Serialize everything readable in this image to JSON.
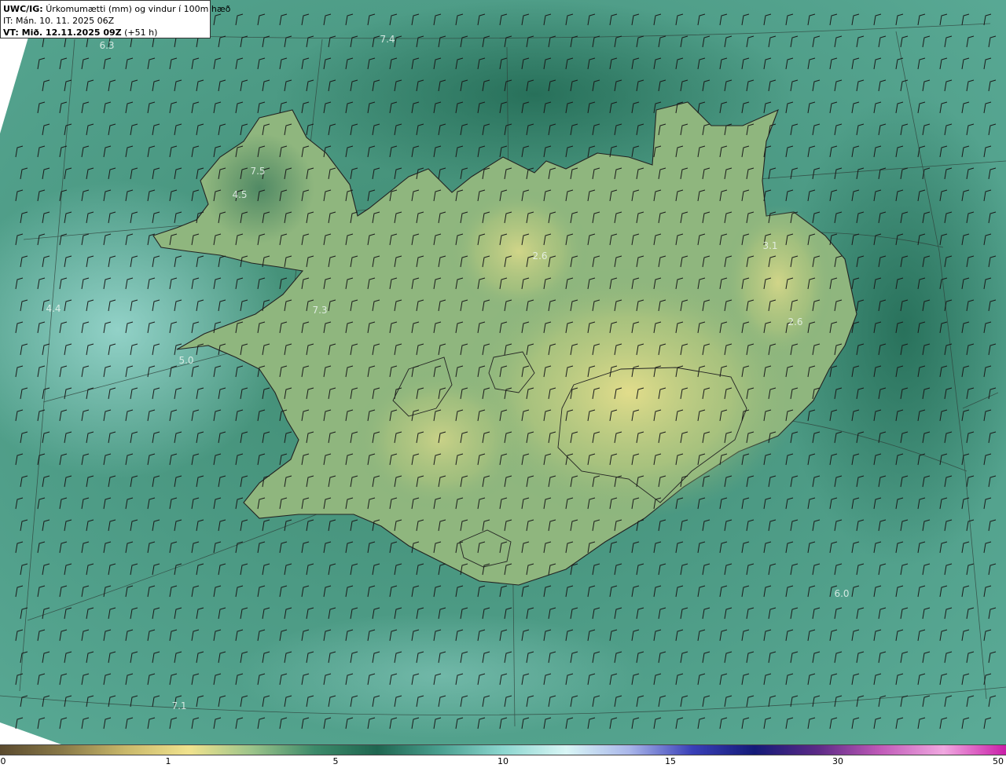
{
  "header": {
    "model": "UWC/IG:",
    "title": "Úrkomumætti (mm) og vindur í 100m hæð",
    "it_line": "IT: Mán. 10. 11. 2025 06Z",
    "vt_label": "VT: Mið. 12.11.2025 09Z",
    "vt_offset": "(+51 h)"
  },
  "map_labels": [
    {
      "text": "6.3",
      "id": "label-6-3"
    },
    {
      "text": "7.4",
      "id": "label-7-4"
    },
    {
      "text": "7.5",
      "id": "label-7-5"
    },
    {
      "text": "4.5",
      "id": "label-4-5"
    },
    {
      "text": "2.6",
      "id": "label-2-6"
    },
    {
      "text": "4.4",
      "id": "label-4-4"
    },
    {
      "text": "7.3",
      "id": "label-7-3"
    },
    {
      "text": "5.0",
      "id": "label-5-0"
    },
    {
      "text": "3.1",
      "id": "label-3-1"
    },
    {
      "text": "2.6",
      "id": "label-2-6b"
    },
    {
      "text": "6.0",
      "id": "label-6-0"
    },
    {
      "text": "7.1",
      "id": "label-7-1"
    }
  ],
  "colorbar": {
    "ticks": [
      "0",
      "1",
      "5",
      "10",
      "15",
      "30",
      "50"
    ],
    "colors": [
      "#5a4a2e",
      "#8a7a48",
      "#c9b86a",
      "#f1e38e",
      "#9cc48a",
      "#3c8a6a",
      "#1f6650",
      "#4aa090",
      "#8cd6cf",
      "#d9f6f6",
      "#aab7ea",
      "#3a40b8",
      "#141a78",
      "#5c2a86",
      "#c05ab8",
      "#f0a8e0",
      "#c91ea8"
    ]
  }
}
